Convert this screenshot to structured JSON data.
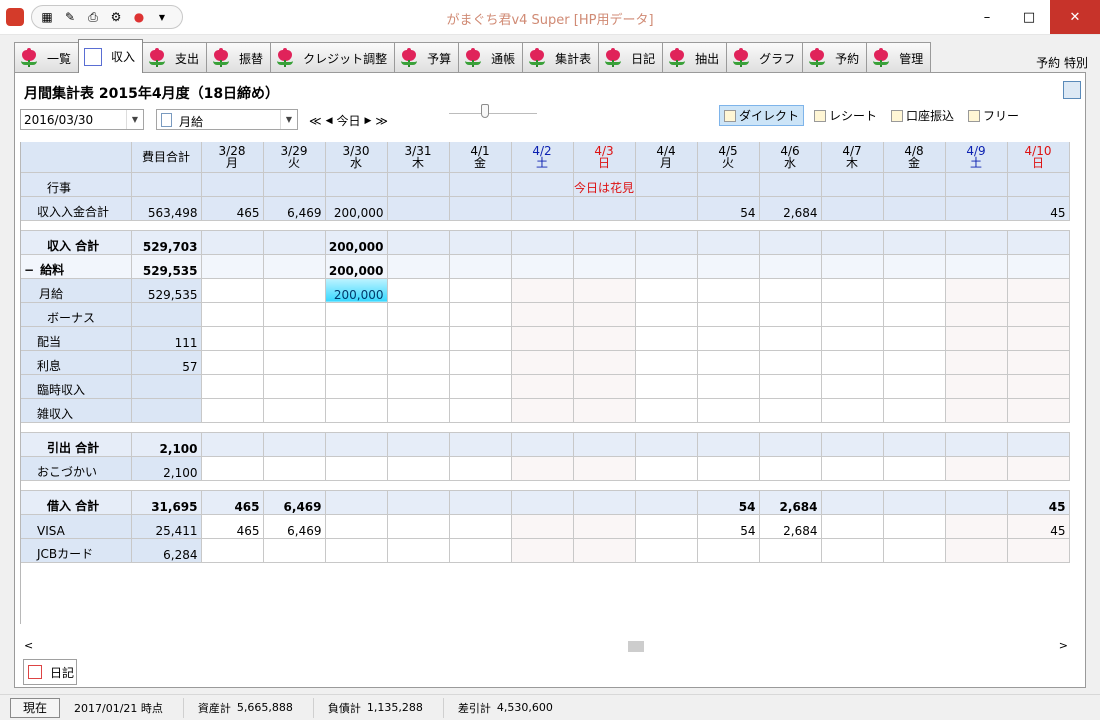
{
  "window": {
    "title": "がまぐち君v4 Super  [HP用データ]",
    "minimize": "–",
    "maximize": "□",
    "close": "✕"
  },
  "tabs": [
    {
      "label": "一覧"
    },
    {
      "label": "収入"
    },
    {
      "label": "支出"
    },
    {
      "label": "振替"
    },
    {
      "label": "クレジット調整"
    },
    {
      "label": "予算"
    },
    {
      "label": "通帳"
    },
    {
      "label": "集計表"
    },
    {
      "label": "日記"
    },
    {
      "label": "抽出"
    },
    {
      "label": "グラフ"
    },
    {
      "label": "予約"
    },
    {
      "label": "管理"
    }
  ],
  "topright": "予約 特別",
  "heading": "月間集計表  2015年4月度（18日締め）",
  "date_value": "2016/03/30",
  "category_value": "月給",
  "nav": {
    "first": "≪",
    "prev": "◀",
    "today": "今日",
    "next": "▶",
    "last": "≫"
  },
  "views": [
    {
      "label": "ダイレクト"
    },
    {
      "label": "レシート"
    },
    {
      "label": "口座振込"
    },
    {
      "label": "フリー"
    }
  ],
  "grid": {
    "total_header": "費目合計",
    "days": [
      {
        "date": "3/28",
        "dow": "月"
      },
      {
        "date": "3/29",
        "dow": "火"
      },
      {
        "date": "3/30",
        "dow": "水"
      },
      {
        "date": "3/31",
        "dow": "木"
      },
      {
        "date": "4/1",
        "dow": "金"
      },
      {
        "date": "4/2",
        "dow": "土"
      },
      {
        "date": "4/3",
        "dow": "日"
      },
      {
        "date": "4/4",
        "dow": "月"
      },
      {
        "date": "4/5",
        "dow": "火"
      },
      {
        "date": "4/6",
        "dow": "水"
      },
      {
        "date": "4/7",
        "dow": "木"
      },
      {
        "date": "4/8",
        "dow": "金"
      },
      {
        "date": "4/9",
        "dow": "土"
      },
      {
        "date": "4/10",
        "dow": "日"
      }
    ],
    "event_label": "行事",
    "event_text": "今日は花見",
    "summary": {
      "label": "収入入金合計",
      "total": "563,498",
      "cells": [
        "465",
        "6,469",
        "200,000",
        "",
        "",
        "",
        "",
        "",
        "54",
        "2,684",
        "",
        "",
        "",
        "45"
      ]
    },
    "sections": [
      {
        "label": "収入 合計",
        "total": "529,703",
        "cells": [
          "",
          "",
          "200,000",
          "",
          "",
          "",
          "",
          "",
          "",
          "",
          "",
          "",
          "",
          ""
        ],
        "groups": [
          {
            "label": "給料",
            "toggle": "−",
            "total": "529,535",
            "cells": [
              "",
              "",
              "200,000",
              "",
              "",
              "",
              "",
              "",
              "",
              "",
              "",
              "",
              "",
              ""
            ],
            "rows": [
              {
                "label": "月給",
                "total": "529,535",
                "cells": [
                  "",
                  "",
                  "200,000",
                  "",
                  "",
                  "",
                  "",
                  "",
                  "",
                  "",
                  "",
                  "",
                  "",
                  ""
                ]
              },
              {
                "label": "ボーナス",
                "total": "",
                "cells": [
                  "",
                  "",
                  "",
                  "",
                  "",
                  "",
                  "",
                  "",
                  "",
                  "",
                  "",
                  "",
                  "",
                  ""
                ]
              }
            ]
          }
        ],
        "rows": [
          {
            "label": "配当",
            "total": "111",
            "cells": [
              "",
              "",
              "",
              "",
              "",
              "",
              "",
              "",
              "",
              "",
              "",
              "",
              "",
              ""
            ]
          },
          {
            "label": "利息",
            "total": "57",
            "cells": [
              "",
              "",
              "",
              "",
              "",
              "",
              "",
              "",
              "",
              "",
              "",
              "",
              "",
              ""
            ]
          },
          {
            "label": "臨時収入",
            "total": "",
            "cells": [
              "",
              "",
              "",
              "",
              "",
              "",
              "",
              "",
              "",
              "",
              "",
              "",
              "",
              ""
            ]
          },
          {
            "label": "雑収入",
            "total": "",
            "cells": [
              "",
              "",
              "",
              "",
              "",
              "",
              "",
              "",
              "",
              "",
              "",
              "",
              "",
              ""
            ]
          }
        ]
      },
      {
        "label": "引出 合計",
        "total": "2,100",
        "cells": [
          "",
          "",
          "",
          "",
          "",
          "",
          "",
          "",
          "",
          "",
          "",
          "",
          "",
          ""
        ],
        "groups": [],
        "rows": [
          {
            "label": "おこづかい",
            "total": "2,100",
            "cells": [
              "",
              "",
              "",
              "",
              "",
              "",
              "",
              "",
              "",
              "",
              "",
              "",
              "",
              ""
            ]
          }
        ]
      },
      {
        "label": "借入 合計",
        "total": "31,695",
        "cells": [
          "465",
          "6,469",
          "",
          "",
          "",
          "",
          "",
          "",
          "54",
          "2,684",
          "",
          "",
          "",
          "45"
        ],
        "groups": [],
        "rows": [
          {
            "label": "VISA",
            "total": "25,411",
            "cells": [
              "465",
              "6,469",
              "",
              "",
              "",
              "",
              "",
              "",
              "54",
              "2,684",
              "",
              "",
              "",
              "45"
            ]
          },
          {
            "label": "JCBカード",
            "total": "6,284",
            "cells": [
              "",
              "",
              "",
              "",
              "",
              "",
              "",
              "",
              "",
              "",
              "",
              "",
              "",
              ""
            ]
          }
        ]
      }
    ]
  },
  "scroll": {
    "left": "<",
    "right": ">"
  },
  "journal_tab": "日記",
  "status": {
    "now_button": "現在",
    "as_of": "2017/01/21 時点",
    "assets_label": "資産計",
    "assets": "5,665,888",
    "liab_label": "負債計",
    "liab": "1,135,288",
    "diff_label": "差引計",
    "diff": "4,530,600"
  }
}
